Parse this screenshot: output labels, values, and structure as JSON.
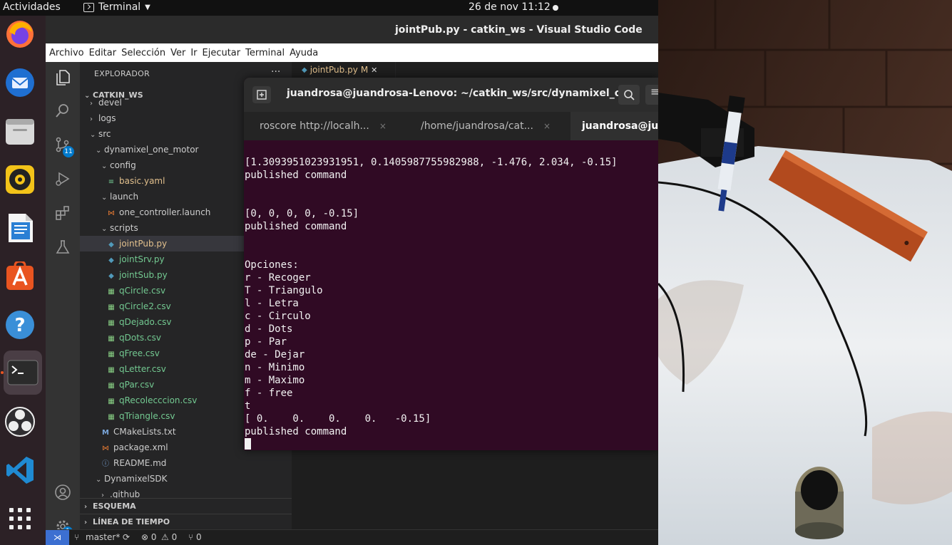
{
  "topbar": {
    "activities": "Actividades",
    "app_name": "Terminal",
    "clock": "26 de nov  11:12"
  },
  "dock": {
    "items": [
      "firefox-icon",
      "thunderbird-icon",
      "files-icon",
      "rhythmbox-icon",
      "writer-icon",
      "software-icon",
      "help-icon",
      "terminal-icon",
      "obs-icon",
      "vscode-icon",
      "apps-grid-icon"
    ]
  },
  "vscode": {
    "title": "jointPub.py - catkin_ws - Visual Studio Code",
    "menu": [
      "Archivo",
      "Editar",
      "Selección",
      "Ver",
      "Ir",
      "Ejecutar",
      "Terminal",
      "Ayuda"
    ],
    "explorer_header": "EXPLORADOR",
    "explorer_more": "···",
    "workspace": "CATKIN_WS",
    "tree": [
      {
        "label": "devel",
        "indent": 1,
        "chev": "›",
        "kind": "folder"
      },
      {
        "label": "logs",
        "indent": 1,
        "chev": "›",
        "kind": "folder"
      },
      {
        "label": "src",
        "indent": 1,
        "chev": "⌄",
        "kind": "folder"
      },
      {
        "label": "dynamixel_one_motor",
        "indent": 2,
        "chev": "⌄",
        "kind": "folder"
      },
      {
        "label": "config",
        "indent": 3,
        "chev": "⌄",
        "kind": "folder"
      },
      {
        "label": "basic.yaml",
        "indent": 4,
        "chev": "",
        "kind": "yaml"
      },
      {
        "label": "launch",
        "indent": 3,
        "chev": "⌄",
        "kind": "folder"
      },
      {
        "label": "one_controller.launch",
        "indent": 4,
        "chev": "",
        "kind": "launch"
      },
      {
        "label": "scripts",
        "indent": 3,
        "chev": "⌄",
        "kind": "folder"
      },
      {
        "label": "jointPub.py",
        "indent": 4,
        "chev": "",
        "kind": "py",
        "selected": true
      },
      {
        "label": "jointSrv.py",
        "indent": 4,
        "chev": "",
        "kind": "py"
      },
      {
        "label": "jointSub.py",
        "indent": 4,
        "chev": "",
        "kind": "py"
      },
      {
        "label": "qCircle.csv",
        "indent": 4,
        "chev": "",
        "kind": "csv"
      },
      {
        "label": "qCircle2.csv",
        "indent": 4,
        "chev": "",
        "kind": "csv"
      },
      {
        "label": "qDejado.csv",
        "indent": 4,
        "chev": "",
        "kind": "csv"
      },
      {
        "label": "qDots.csv",
        "indent": 4,
        "chev": "",
        "kind": "csv"
      },
      {
        "label": "qFree.csv",
        "indent": 4,
        "chev": "",
        "kind": "csv"
      },
      {
        "label": "qLetter.csv",
        "indent": 4,
        "chev": "",
        "kind": "csv"
      },
      {
        "label": "qPar.csv",
        "indent": 4,
        "chev": "",
        "kind": "csv"
      },
      {
        "label": "qRecolecccion.csv",
        "indent": 4,
        "chev": "",
        "kind": "csv"
      },
      {
        "label": "qTriangle.csv",
        "indent": 4,
        "chev": "",
        "kind": "csv"
      },
      {
        "label": "CMakeLists.txt",
        "indent": 3,
        "chev": "",
        "kind": "cmake"
      },
      {
        "label": "package.xml",
        "indent": 3,
        "chev": "",
        "kind": "xml"
      },
      {
        "label": "README.md",
        "indent": 3,
        "chev": "",
        "kind": "md"
      },
      {
        "label": "DynamixelSDK",
        "indent": 2,
        "chev": "⌄",
        "kind": "folder"
      },
      {
        "label": ".github",
        "indent": 3,
        "chev": "›",
        "kind": "folder"
      }
    ],
    "outline_label": "ESQUEMA",
    "timeline_label": "LÍNEA DE TIEMPO",
    "scm_badge": "11",
    "settings_badge": "1",
    "editor_tab": {
      "name": "jointPub.py",
      "modified": "M",
      "close": "✕"
    },
    "statusbar": {
      "remote": "⋊",
      "branch": "master*",
      "sync": "⟳",
      "errors": "⊗ 0",
      "warnings": "⚠ 0",
      "ports": "⑂ 0"
    }
  },
  "terminal": {
    "title": "juandrosa@juandrosa-Lenovo: ~/catkin_ws/src/dynamixel_on...",
    "tabs": [
      {
        "label": "roscore http://localh...",
        "close": "×"
      },
      {
        "label": "/home/juandrosa/cat...",
        "close": "×"
      },
      {
        "label": "juandrosa@jua",
        "close": ""
      }
    ],
    "lines": [
      "[1.3093951023931951, 0.1405987755982988, -1.476, 2.034, -0.15]",
      "published command",
      "",
      "",
      "[0, 0, 0, 0, -0.15]",
      "published command",
      "",
      "",
      "Opciones:",
      "r - Recoger",
      "T - Triangulo",
      "l - Letra",
      "c - Circulo",
      "d - Dots",
      "p - Par",
      "de - Dejar",
      "n - Minimo",
      "m - Maximo",
      "f - free",
      "t",
      "[ 0.    0.    0.    0.   -0.15]",
      "published command"
    ]
  },
  "colors": {
    "terminal_bg": "#300a24",
    "vscode_bg": "#1e1e1e",
    "sidebar_bg": "#252526",
    "dock_bg": "#2c2126",
    "accent_ubuntu": "#e95420",
    "vscode_blue": "#007acc"
  }
}
